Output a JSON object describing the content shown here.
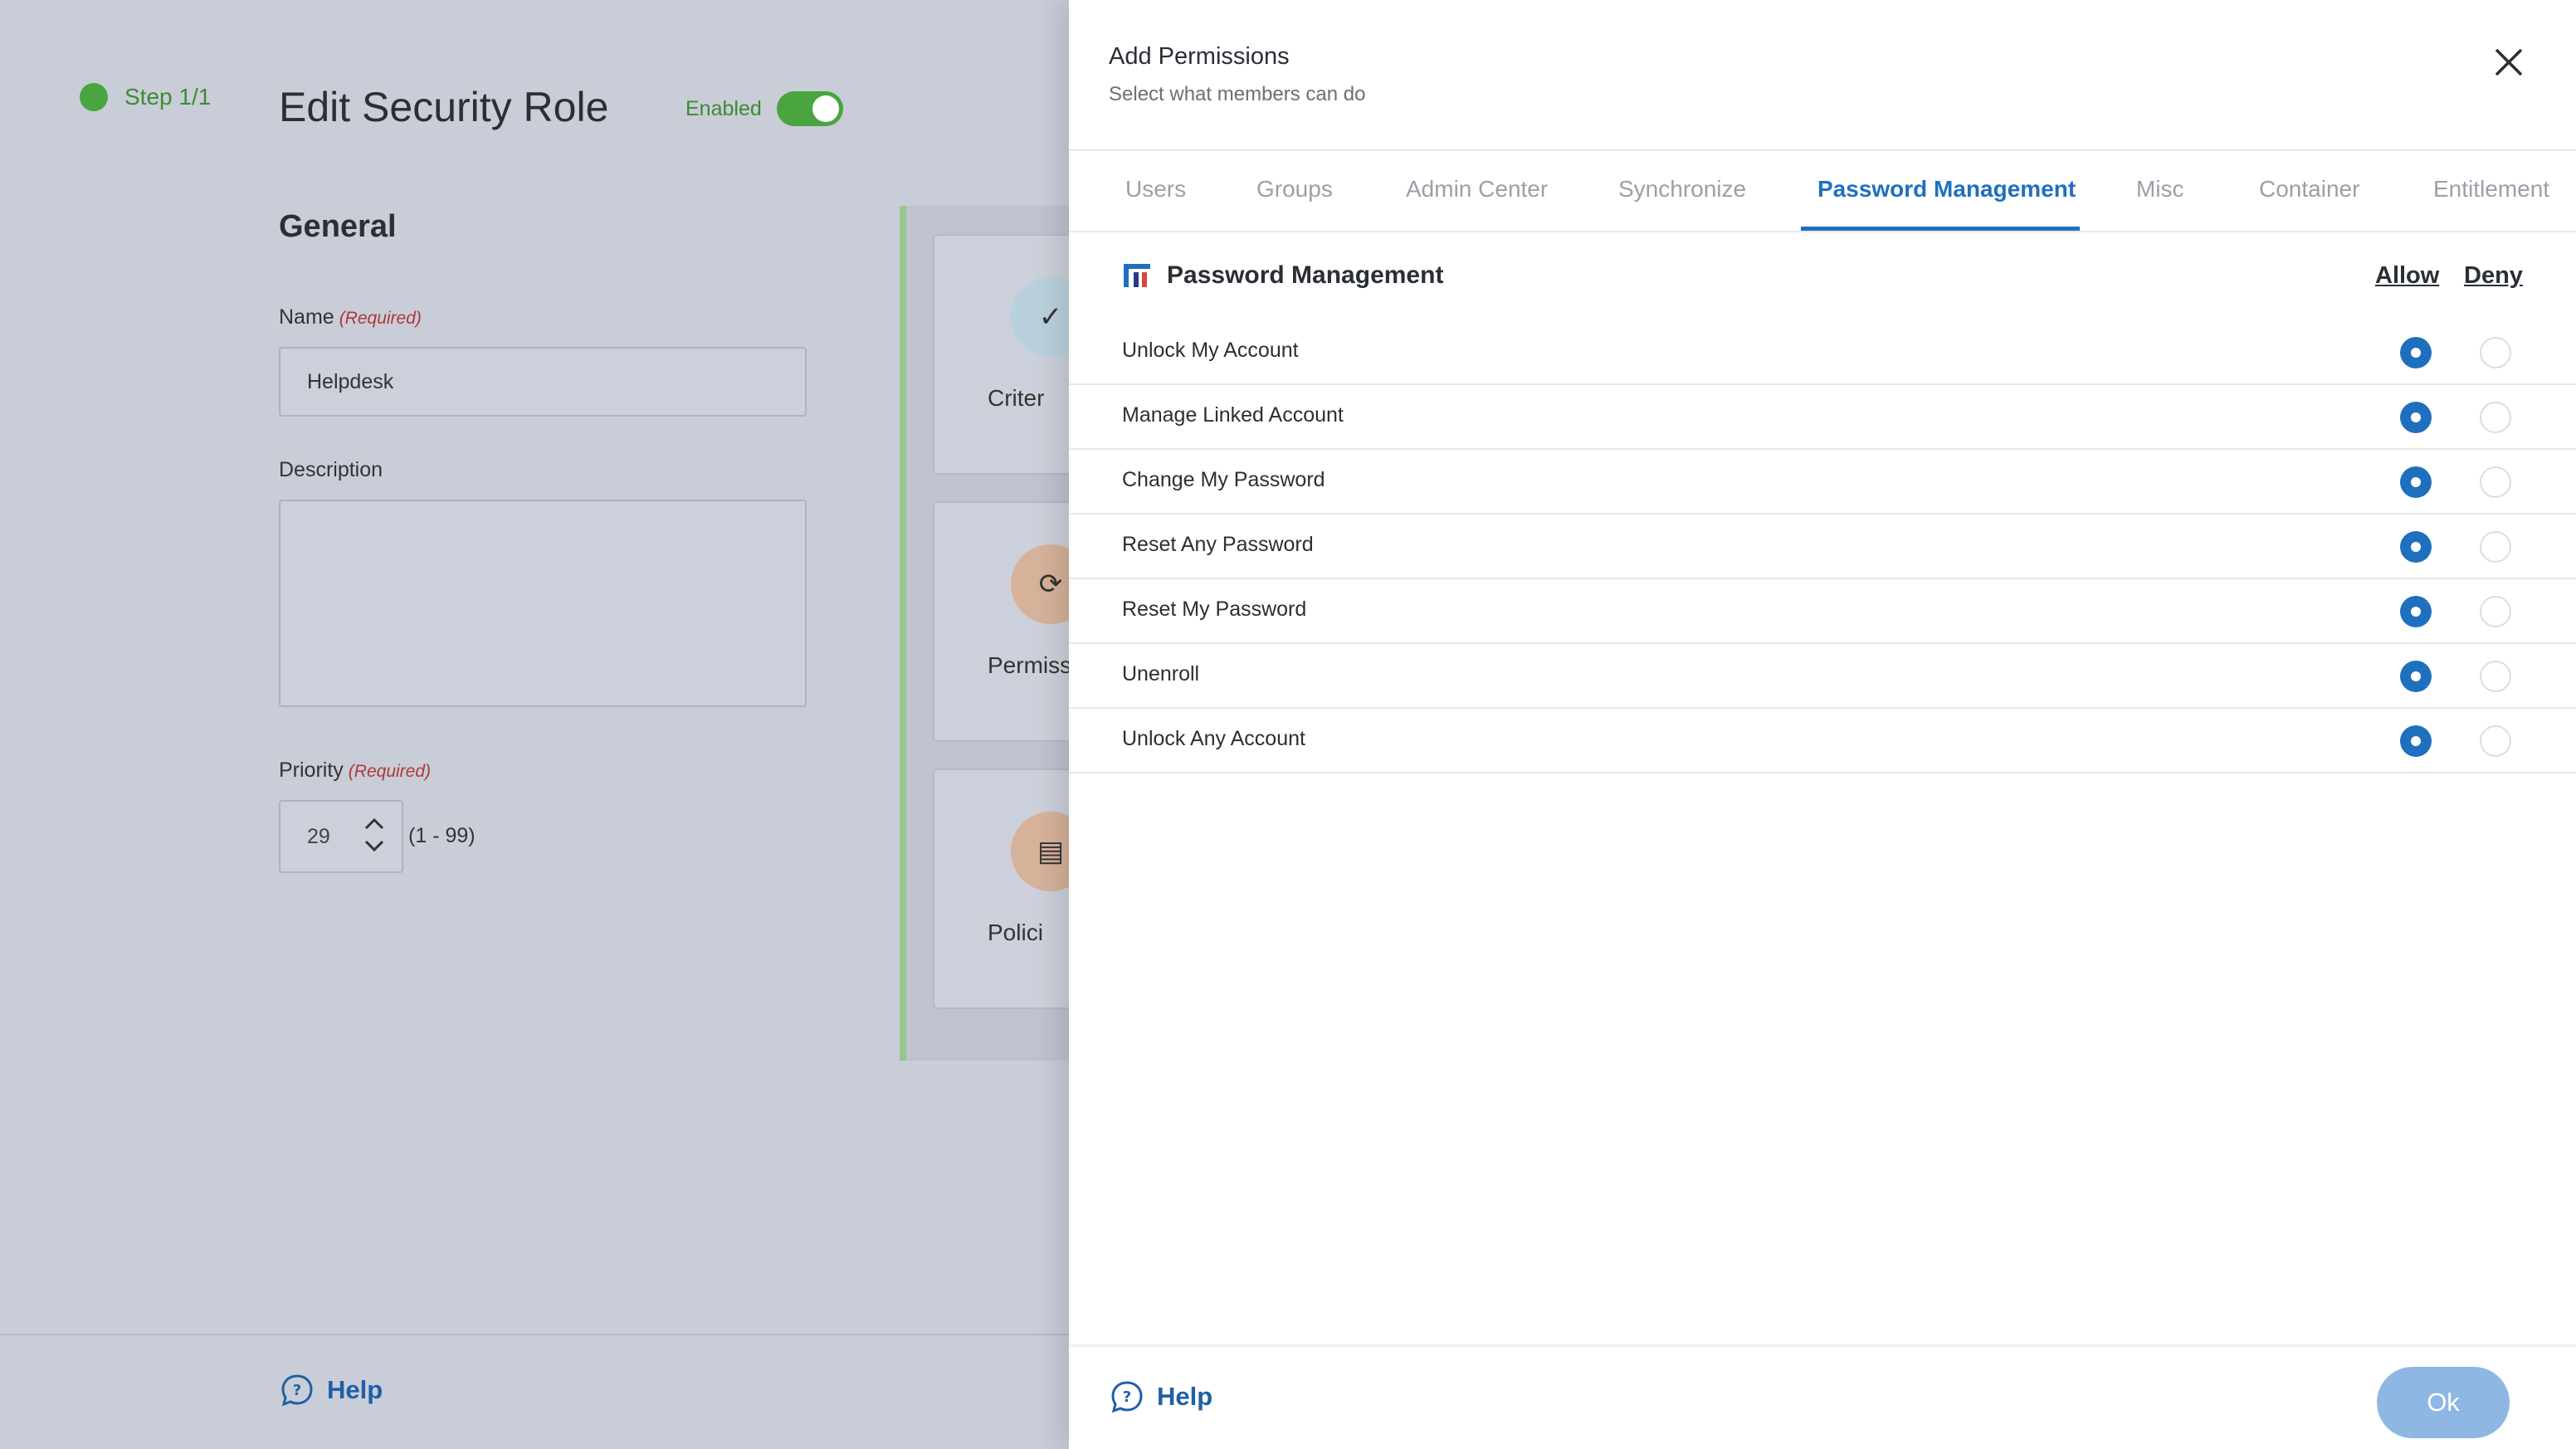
{
  "background": {
    "step": "Step 1/1",
    "title": "Edit Security Role",
    "enabled_label": "Enabled",
    "enabled": true,
    "section_title": "General",
    "name_label": "Name",
    "required_tag": "(Required)",
    "name_value": "Helpdesk",
    "description_label": "Description",
    "description_value": "",
    "priority_label": "Priority",
    "priority_value": "29",
    "priority_range": "(1 - 99)",
    "cards": [
      {
        "label": "Criter",
        "icon": "check-icon"
      },
      {
        "label": "Permiss",
        "icon": "refresh-icon"
      },
      {
        "label": "Polici",
        "icon": "document-icon"
      }
    ],
    "help_label": "Help"
  },
  "drawer": {
    "title": "Add Permissions",
    "subtitle": "Select what members can do",
    "tabs": [
      "Users",
      "Groups",
      "Admin Center",
      "Synchronize",
      "Password Management",
      "Misc",
      "Container",
      "Entitlement"
    ],
    "active_tab": "Password Management",
    "section_title": "Password Management",
    "allow_label": "Allow",
    "deny_label": "Deny",
    "permissions": [
      {
        "label": "Unlock My Account",
        "value": "allow"
      },
      {
        "label": "Manage Linked Account",
        "value": "allow"
      },
      {
        "label": "Change My Password",
        "value": "allow"
      },
      {
        "label": "Reset Any Password",
        "value": "allow"
      },
      {
        "label": "Reset My Password",
        "value": "allow"
      },
      {
        "label": "Unenroll",
        "value": "allow"
      },
      {
        "label": "Unlock Any Account",
        "value": "allow"
      }
    ],
    "help_label": "Help",
    "ok_label": "Ok"
  },
  "colors": {
    "accent": "#1f6fbf",
    "enabled_green": "#4aa540",
    "ok_button": "#8fb7e4"
  }
}
